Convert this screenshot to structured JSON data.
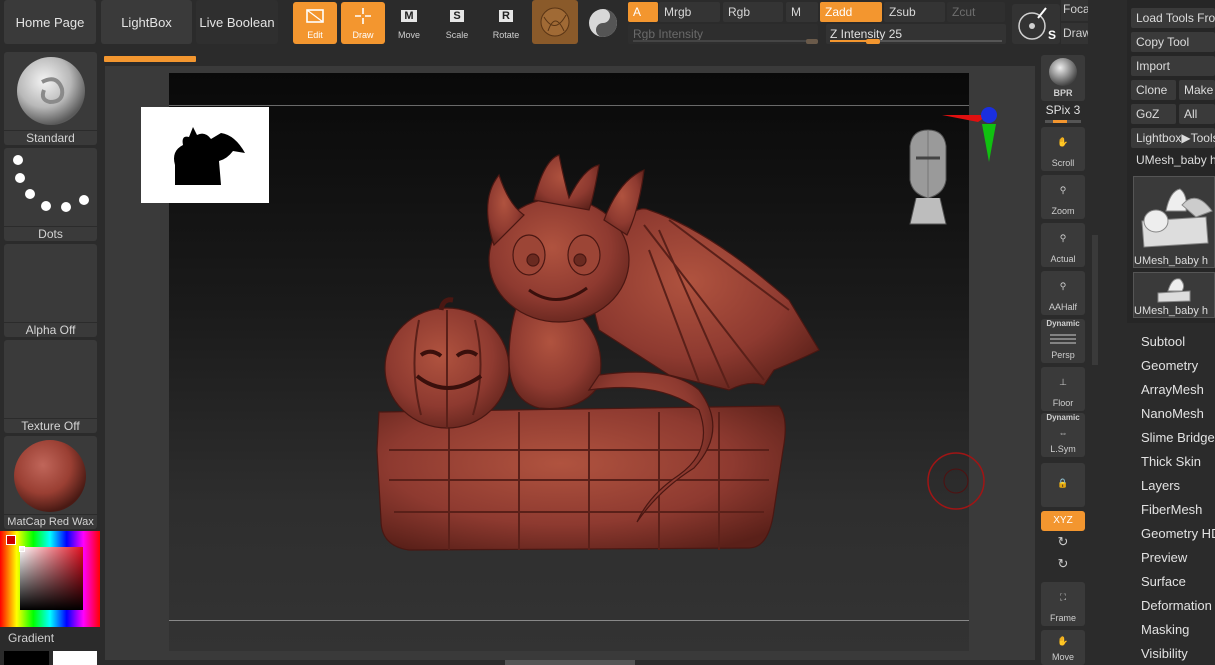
{
  "top_tabs": {
    "home": "Home Page",
    "lightbox": "LightBox",
    "live_boolean": "Live Boolean"
  },
  "tools": {
    "edit": "Edit",
    "draw": "Draw",
    "move": "Move",
    "scale": "Scale",
    "rotate": "Rotate",
    "move_key": "M",
    "scale_key": "S",
    "rotate_key": "R"
  },
  "channels": {
    "a": "A",
    "mrgb": "Mrgb",
    "rgb": "Rgb",
    "m": "M",
    "zadd": "Zadd",
    "zsub": "Zsub",
    "zcut": "Zcut"
  },
  "sliders": {
    "rgb_intensity": "Rgb Intensity",
    "z_intensity_label": "Z Intensity",
    "z_intensity_value": "25",
    "z_intensity_level": 0.25
  },
  "focal": {
    "focal": "Foca",
    "draw": "Draw",
    "s_label": "S"
  },
  "left_shelf": {
    "brush": "Standard",
    "stroke": "Dots",
    "alpha": "Alpha Off",
    "texture": "Texture Off",
    "material": "MatCap Red Wax",
    "gradient": "Gradient"
  },
  "right_shelf": {
    "bpr": "BPR",
    "spix": "SPix 3",
    "scroll": "Scroll",
    "zoom": "Zoom",
    "actual": "Actual",
    "aahalf": "AAHalf",
    "dynamic": "Dynamic",
    "persp": "Persp",
    "floor": "Floor",
    "dynamic2": "Dynamic",
    "lsym": "L.Sym",
    "xyz": "XYZ",
    "frame": "Frame",
    "move": "Move"
  },
  "tool_panel": {
    "load": "Load Tools From",
    "copy": "Copy Tool",
    "import": "Import",
    "clone": "Clone",
    "make": "Make",
    "goz": "GoZ",
    "all": "All",
    "lightbox_tools": "Lightbox▶Tools",
    "current": "UMesh_baby h",
    "thumb1": "UMesh_baby h",
    "thumb2": "UMesh_baby h"
  },
  "menu": [
    "Subtool",
    "Geometry",
    "ArrayMesh",
    "NanoMesh",
    "Slime Bridge",
    "Thick Skin",
    "Layers",
    "FiberMesh",
    "Geometry HD",
    "Preview",
    "Surface",
    "Deformation",
    "Masking",
    "Visibility"
  ],
  "colors": {
    "accent": "#f3962f",
    "model": "#8e3a30",
    "material": "#9a3f33"
  }
}
